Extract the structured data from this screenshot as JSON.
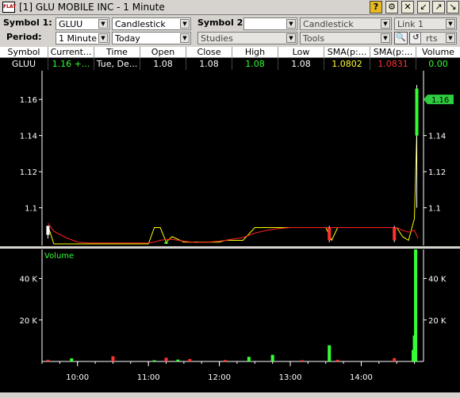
{
  "window": {
    "title": "[1] GLU MOBILE INC - 1 Minute",
    "icon_label": "FLAT"
  },
  "controls": {
    "symbol1_label": "Symbol 1:",
    "symbol1_value": "GLUU",
    "chart_type1": "Candlestick",
    "symbol2_label": "Symbol 2:",
    "symbol2_value": "",
    "chart_type2": "Candlestick",
    "link_value": "Link 1",
    "period_label": "Period:",
    "period_value": "1 Minute",
    "range_value": "Today",
    "studies_value": "Studies",
    "tools_value": "Tools",
    "reports_value": "rts"
  },
  "quote": {
    "headers": [
      "Symbol",
      "Current...",
      "Time",
      "Open",
      "Close",
      "High",
      "Low",
      "SMA(p:...",
      "SMA(p:...",
      "Volume"
    ],
    "row": {
      "symbol": "GLUU",
      "current": "1.16 +...",
      "time": "Tue, De...",
      "open": "1.08",
      "close": "1.08",
      "high": "1.08",
      "low": "1.08",
      "sma1": "1.0802",
      "sma2": "1.0831",
      "volume": "0.00"
    },
    "colors": {
      "current": "#33ff33",
      "high": "#33ff33",
      "sma1": "#ffff33",
      "sma2": "#ff3333",
      "volume": "#33ff33"
    }
  },
  "chart_data": [
    {
      "type": "line",
      "title": "",
      "price_ticks": [
        "1.16",
        "1.14",
        "1.12",
        "1.1"
      ],
      "ylim": [
        1.08,
        1.168
      ],
      "current_price_label": "1.16",
      "x": [
        "09:35",
        "09:40",
        "09:50",
        "10:00",
        "10:10",
        "10:20",
        "10:30",
        "10:40",
        "10:50",
        "11:00",
        "11:05",
        "11:10",
        "11:15",
        "11:20",
        "11:30",
        "11:40",
        "11:50",
        "12:00",
        "12:05",
        "12:10",
        "12:20",
        "12:30",
        "12:40",
        "12:50",
        "13:00",
        "13:10",
        "13:20",
        "13:30",
        "13:33",
        "13:35",
        "13:40",
        "13:45",
        "13:50",
        "14:00",
        "14:10",
        "14:20",
        "14:25",
        "14:30",
        "14:35",
        "14:40",
        "14:45",
        "14:48"
      ],
      "series": [
        {
          "color": "#ffff00",
          "values": [
            1.09,
            1.08,
            1.08,
            1.08,
            1.08,
            1.08,
            1.08,
            1.08,
            1.08,
            1.08,
            1.089,
            1.089,
            1.081,
            1.084,
            1.081,
            1.081,
            1.081,
            1.081,
            1.082,
            1.082,
            1.082,
            1.089,
            1.089,
            1.089,
            1.089,
            1.089,
            1.089,
            1.089,
            1.085,
            1.082,
            1.089,
            1.089,
            1.089,
            1.089,
            1.089,
            1.089,
            1.089,
            1.089,
            1.084,
            1.082,
            1.094,
            1.166
          ]
        },
        {
          "color": "#ff2020",
          "values": [
            1.0915,
            1.087,
            1.0835,
            1.081,
            1.0805,
            1.0805,
            1.0805,
            1.0805,
            1.0805,
            1.0805,
            1.081,
            1.082,
            1.0825,
            1.0825,
            1.0815,
            1.0808,
            1.081,
            1.0815,
            1.082,
            1.0825,
            1.0835,
            1.086,
            1.0875,
            1.0885,
            1.089,
            1.089,
            1.089,
            1.089,
            1.089,
            1.089,
            1.089,
            1.089,
            1.089,
            1.089,
            1.089,
            1.089,
            1.089,
            1.089,
            1.0875,
            1.0865,
            1.0875,
            1.0831
          ]
        }
      ],
      "candles": [
        {
          "x": "09:35",
          "open": 1.09,
          "close": 1.085,
          "high": 1.09,
          "low": 1.083,
          "color": "#ffffff"
        },
        {
          "x": "11:15",
          "open": 1.081,
          "close": 1.08,
          "high": 1.081,
          "low": 1.08,
          "color": "#33ff33"
        },
        {
          "x": "13:33",
          "open": 1.089,
          "close": 1.082,
          "high": 1.09,
          "low": 1.081,
          "color": "#ff3030"
        },
        {
          "x": "14:28",
          "open": 1.089,
          "close": 1.082,
          "high": 1.09,
          "low": 1.081,
          "color": "#ff3030"
        },
        {
          "x": "14:47",
          "open": 1.14,
          "close": 1.166,
          "high": 1.168,
          "low": 1.1,
          "color": "#33ff33"
        }
      ]
    },
    {
      "type": "bar",
      "title": "Volume",
      "volume_ticks": [
        "40 K",
        "20 K"
      ],
      "ylim": [
        0,
        54000
      ],
      "bars": [
        {
          "x": "09:35",
          "value": 800,
          "color": "#ff3030"
        },
        {
          "x": "09:55",
          "value": 1500,
          "color": "#33ff33"
        },
        {
          "x": "10:30",
          "value": 2500,
          "color": "#ff3030"
        },
        {
          "x": "11:05",
          "value": 600,
          "color": "#33ff33"
        },
        {
          "x": "11:15",
          "value": 1800,
          "color": "#ff3030"
        },
        {
          "x": "11:25",
          "value": 900,
          "color": "#33ff33"
        },
        {
          "x": "11:35",
          "value": 1200,
          "color": "#ff3030"
        },
        {
          "x": "12:05",
          "value": 700,
          "color": "#ff3030"
        },
        {
          "x": "12:25",
          "value": 2200,
          "color": "#33ff33"
        },
        {
          "x": "12:45",
          "value": 3200,
          "color": "#33ff33"
        },
        {
          "x": "13:10",
          "value": 600,
          "color": "#ff3030"
        },
        {
          "x": "13:33",
          "value": 7800,
          "color": "#33ff33"
        },
        {
          "x": "13:40",
          "value": 800,
          "color": "#ff3030"
        },
        {
          "x": "14:28",
          "value": 1600,
          "color": "#ff3030"
        },
        {
          "x": "14:44",
          "value": 5500,
          "color": "#33ff33"
        },
        {
          "x": "14:45",
          "value": 12500,
          "color": "#33ff33"
        },
        {
          "x": "14:46",
          "value": 54000,
          "color": "#33ff33"
        }
      ]
    }
  ],
  "time_axis": {
    "labels": [
      "10:00",
      "11:00",
      "12:00",
      "13:00",
      "14:00"
    ]
  }
}
